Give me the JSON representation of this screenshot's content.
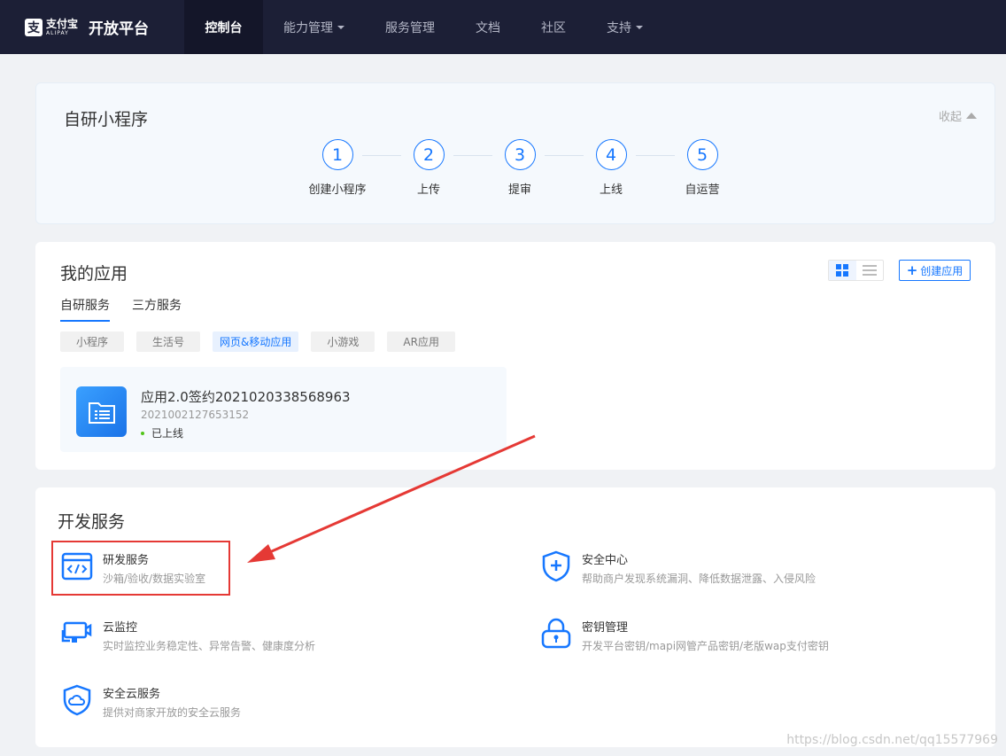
{
  "nav": {
    "logo_cn": "支付宝",
    "logo_en": "ALIPAY",
    "platform": "开放平台",
    "items": [
      {
        "label": "控制台",
        "active": true,
        "caret": false
      },
      {
        "label": "能力管理",
        "active": false,
        "caret": true
      },
      {
        "label": "服务管理",
        "active": false,
        "caret": false
      },
      {
        "label": "文档",
        "active": false,
        "caret": false
      },
      {
        "label": "社区",
        "active": false,
        "caret": false
      },
      {
        "label": "支持",
        "active": false,
        "caret": true
      }
    ]
  },
  "steps_card": {
    "title": "自研小程序",
    "collapse_label": "收起",
    "steps": [
      {
        "num": "1",
        "label": "创建小程序"
      },
      {
        "num": "2",
        "label": "上传"
      },
      {
        "num": "3",
        "label": "提审"
      },
      {
        "num": "4",
        "label": "上线"
      },
      {
        "num": "5",
        "label": "自运营"
      }
    ]
  },
  "apps_card": {
    "title": "我的应用",
    "create_label": "创建应用",
    "tabs": [
      {
        "label": "自研服务",
        "active": true
      },
      {
        "label": "三方服务",
        "active": false
      }
    ],
    "chips": [
      {
        "label": "小程序",
        "active": false
      },
      {
        "label": "生活号",
        "active": false
      },
      {
        "label": "网页&移动应用",
        "active": true
      },
      {
        "label": "小游戏",
        "active": false
      },
      {
        "label": "AR应用",
        "active": false
      }
    ],
    "app": {
      "name": "应用2.0签约2021020338568963",
      "id": "2021002127653152",
      "status": "已上线"
    }
  },
  "dev_card": {
    "title": "开发服务",
    "services": [
      {
        "name": "研发服务",
        "desc": "沙箱/验收/数据实验室",
        "icon": "code-window-icon"
      },
      {
        "name": "安全中心",
        "desc": "帮助商户发现系统漏洞、降低数据泄露、入侵风险",
        "icon": "shield-plus-icon"
      },
      {
        "name": "云监控",
        "desc": "实时监控业务稳定性、异常告警、健康度分析",
        "icon": "monitor-camera-icon"
      },
      {
        "name": "密钥管理",
        "desc": "开发平台密钥/mapi网管产品密钥/老版wap支付密钥",
        "icon": "lock-icon"
      },
      {
        "name": "安全云服务",
        "desc": "提供对商家开放的安全云服务",
        "icon": "shield-cloud-icon"
      }
    ]
  },
  "watermark": "https://blog.csdn.net/qq15577969",
  "colors": {
    "accent": "#1677ff",
    "nav_bg": "#1c1f36",
    "highlight": "#e53935"
  }
}
